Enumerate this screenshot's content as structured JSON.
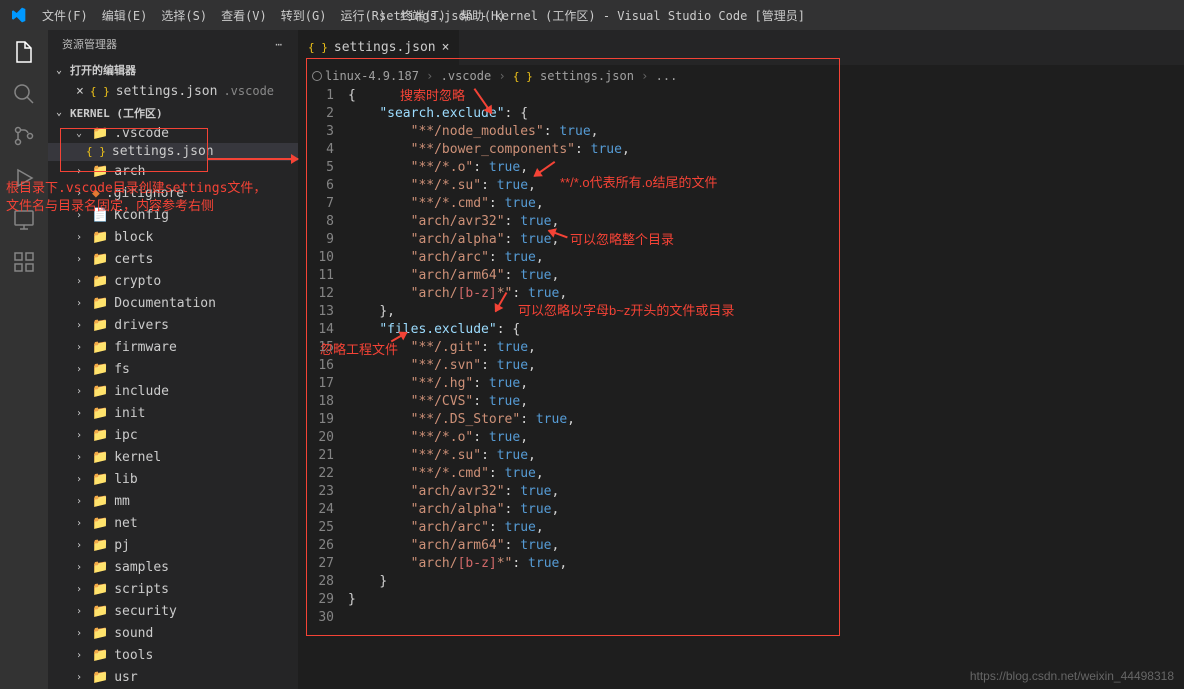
{
  "title": "settings.json - kernel (工作区) - Visual Studio Code [管理员]",
  "menu": [
    "文件(F)",
    "编辑(E)",
    "选择(S)",
    "查看(V)",
    "转到(G)",
    "运行(R)",
    "终端(T)",
    "帮助(H)"
  ],
  "sidebar_title": "资源管理器",
  "open_editors_label": "打开的编辑器",
  "open_editor_file": "settings.json",
  "open_editor_path": ".vscode",
  "workspace_label": "KERNEL (工作区)",
  "vscode_folder": ".vscode",
  "settings_file": "settings.json",
  "folders": [
    "arch",
    ".gitignore",
    "Kconfig",
    "block",
    "certs",
    "crypto",
    "Documentation",
    "drivers",
    "firmware",
    "fs",
    "include",
    "init",
    "ipc",
    "kernel",
    "lib",
    "mm",
    "net",
    "pj",
    "samples",
    "scripts",
    "security",
    "sound",
    "tools",
    "usr"
  ],
  "tab_name": "settings.json",
  "breadcrumb": [
    "linux-4.9.187",
    ".vscode",
    "settings.json",
    "..."
  ],
  "code_lines": [
    {
      "n": 1,
      "html": "<span class='k-punc'>{</span>"
    },
    {
      "n": 2,
      "html": "    <span class='k-key'>\"search.exclude\"</span><span class='k-punc'>: {</span>"
    },
    {
      "n": 3,
      "html": "        <span class='k-str'>\"**/node_modules\"</span><span class='k-punc'>: </span><span class='k-bool'>true</span><span class='k-punc'>,</span>"
    },
    {
      "n": 4,
      "html": "        <span class='k-str'>\"**/bower_components\"</span><span class='k-punc'>: </span><span class='k-bool'>true</span><span class='k-punc'>,</span>"
    },
    {
      "n": 5,
      "html": "        <span class='k-str'>\"**/*.o\"</span><span class='k-punc'>: </span><span class='k-bool'>true</span><span class='k-punc'>,</span>"
    },
    {
      "n": 6,
      "html": "        <span class='k-str'>\"**/*.su\"</span><span class='k-punc'>: </span><span class='k-bool'>true</span><span class='k-punc'>,</span>"
    },
    {
      "n": 7,
      "html": "        <span class='k-str'>\"**/*.cmd\"</span><span class='k-punc'>: </span><span class='k-bool'>true</span><span class='k-punc'>,</span>"
    },
    {
      "n": 8,
      "html": "        <span class='k-str'>\"arch/avr32\"</span><span class='k-punc'>: </span><span class='k-bool'>true</span><span class='k-punc'>,</span>"
    },
    {
      "n": 9,
      "html": "        <span class='k-str'>\"arch/alpha\"</span><span class='k-punc'>: </span><span class='k-bool'>true</span><span class='k-punc'>,</span>"
    },
    {
      "n": 10,
      "html": "        <span class='k-str'>\"arch/arc\"</span><span class='k-punc'>: </span><span class='k-bool'>true</span><span class='k-punc'>,</span>"
    },
    {
      "n": 11,
      "html": "        <span class='k-str'>\"arch/arm64\"</span><span class='k-punc'>: </span><span class='k-bool'>true</span><span class='k-punc'>,</span>"
    },
    {
      "n": 12,
      "html": "        <span class='k-str'>\"arch/</span><span class='k-re'>[b-z]</span><span class='k-str'>*\"</span><span class='k-punc'>: </span><span class='k-bool'>true</span><span class='k-punc'>,</span>"
    },
    {
      "n": 13,
      "html": "    <span class='k-punc'>},</span>"
    },
    {
      "n": 14,
      "html": "    <span class='k-key'>\"files.exclude\"</span><span class='k-punc'>: {</span>"
    },
    {
      "n": 15,
      "html": "        <span class='k-str'>\"**/.git\"</span><span class='k-punc'>: </span><span class='k-bool'>true</span><span class='k-punc'>,</span>"
    },
    {
      "n": 16,
      "html": "        <span class='k-str'>\"**/.svn\"</span><span class='k-punc'>: </span><span class='k-bool'>true</span><span class='k-punc'>,</span>"
    },
    {
      "n": 17,
      "html": "        <span class='k-str'>\"**/.hg\"</span><span class='k-punc'>: </span><span class='k-bool'>true</span><span class='k-punc'>,</span>"
    },
    {
      "n": 18,
      "html": "        <span class='k-str'>\"**/CVS\"</span><span class='k-punc'>: </span><span class='k-bool'>true</span><span class='k-punc'>,</span>"
    },
    {
      "n": 19,
      "html": "        <span class='k-str'>\"**/.DS_Store\"</span><span class='k-punc'>: </span><span class='k-bool'>true</span><span class='k-punc'>,</span>"
    },
    {
      "n": 20,
      "html": "        <span class='k-str'>\"**/*.o\"</span><span class='k-punc'>: </span><span class='k-bool'>true</span><span class='k-punc'>,</span>"
    },
    {
      "n": 21,
      "html": "        <span class='k-str'>\"**/*.su\"</span><span class='k-punc'>: </span><span class='k-bool'>true</span><span class='k-punc'>,</span>"
    },
    {
      "n": 22,
      "html": "        <span class='k-str'>\"**/*.cmd\"</span><span class='k-punc'>: </span><span class='k-bool'>true</span><span class='k-punc'>,</span>"
    },
    {
      "n": 23,
      "html": "        <span class='k-str'>\"arch/avr32\"</span><span class='k-punc'>: </span><span class='k-bool'>true</span><span class='k-punc'>,</span>"
    },
    {
      "n": 24,
      "html": "        <span class='k-str'>\"arch/alpha\"</span><span class='k-punc'>: </span><span class='k-bool'>true</span><span class='k-punc'>,</span>"
    },
    {
      "n": 25,
      "html": "        <span class='k-str'>\"arch/arc\"</span><span class='k-punc'>: </span><span class='k-bool'>true</span><span class='k-punc'>,</span>"
    },
    {
      "n": 26,
      "html": "        <span class='k-str'>\"arch/arm64\"</span><span class='k-punc'>: </span><span class='k-bool'>true</span><span class='k-punc'>,</span>"
    },
    {
      "n": 27,
      "html": "        <span class='k-str'>\"arch/</span><span class='k-re'>[b-z]</span><span class='k-str'>*\"</span><span class='k-punc'>: </span><span class='k-bool'>true</span><span class='k-punc'>,</span>"
    },
    {
      "n": 28,
      "html": "    <span class='k-punc'>}</span>"
    },
    {
      "n": 29,
      "html": "<span class='k-punc'>}</span>"
    },
    {
      "n": 30,
      "html": ""
    }
  ],
  "annotations": {
    "search_ignore": "搜索时忽略",
    "o_files": "**/*.o代表所有.o结尾的文件",
    "whole_dir": "可以忽略整个目录",
    "bz_files": "可以忽略以字母b~z开头的文件或目录",
    "project_files": "忽略工程文件",
    "root_note_l1": "根目录下.vscode目录创建settings文件，",
    "root_note_l2": "文件名与目录名固定，内容参考右侧"
  },
  "watermark": "https://blog.csdn.net/weixin_44498318"
}
